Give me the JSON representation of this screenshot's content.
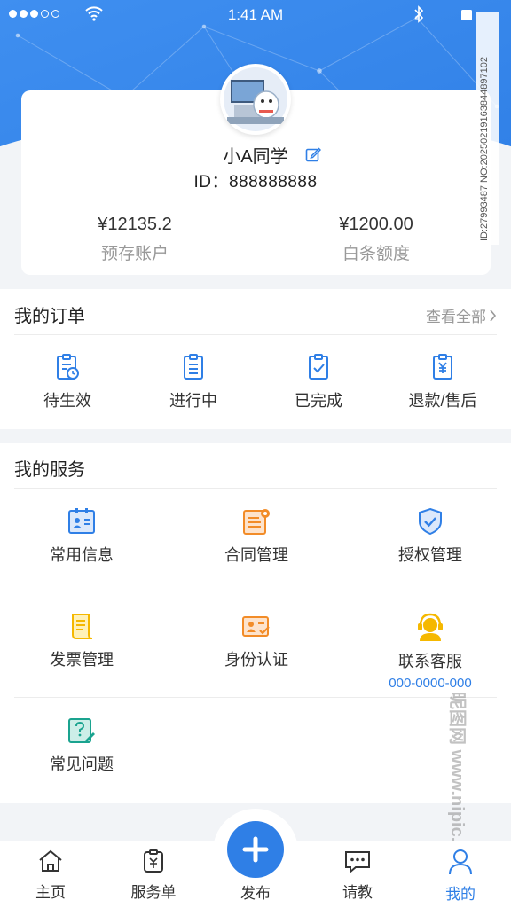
{
  "status_bar": {
    "time": "1:41 AM"
  },
  "profile": {
    "username": "小A同学",
    "user_id": "ID：888888888",
    "balances": [
      {
        "value": "¥12135.2",
        "label": "预存账户"
      },
      {
        "value": "¥1200.00",
        "label": "白条额度"
      }
    ]
  },
  "watermark": "ID:27993487 NO:20250219163844897102",
  "orders": {
    "title": "我的订单",
    "view_all": "查看全部",
    "items": [
      {
        "label": "待生效",
        "icon": "clipboard-clock-icon"
      },
      {
        "label": "进行中",
        "icon": "clipboard-list-icon"
      },
      {
        "label": "已完成",
        "icon": "clipboard-check-icon"
      },
      {
        "label": "退款/售后",
        "icon": "clipboard-yen-icon"
      }
    ]
  },
  "services": {
    "title": "我的服务",
    "items": [
      {
        "label": "常用信息",
        "icon": "id-card-icon"
      },
      {
        "label": "合同管理",
        "icon": "contract-gear-icon"
      },
      {
        "label": "授权管理",
        "icon": "shield-check-icon"
      },
      {
        "label": "发票管理",
        "icon": "invoice-icon"
      },
      {
        "label": "身份认证",
        "icon": "identity-card-icon"
      },
      {
        "label": "联系客服",
        "icon": "headset-agent-icon",
        "sub": "000-0000-000"
      },
      {
        "label": "常见问题",
        "icon": "faq-doc-icon"
      }
    ]
  },
  "tabbar": {
    "tabs": [
      {
        "label": "主页",
        "icon": "home-icon"
      },
      {
        "label": "服务单",
        "icon": "service-order-icon"
      },
      {
        "label": "发布",
        "icon": "plus-icon"
      },
      {
        "label": "请教",
        "icon": "chat-icon"
      },
      {
        "label": "我的",
        "icon": "user-icon",
        "active": true
      }
    ]
  },
  "site_watermark": "昵图网 www.nipic.com",
  "colors": {
    "primary": "#2f7fe6",
    "orange": "#f28c28",
    "yellow": "#f5b800",
    "teal": "#1aa38f"
  }
}
